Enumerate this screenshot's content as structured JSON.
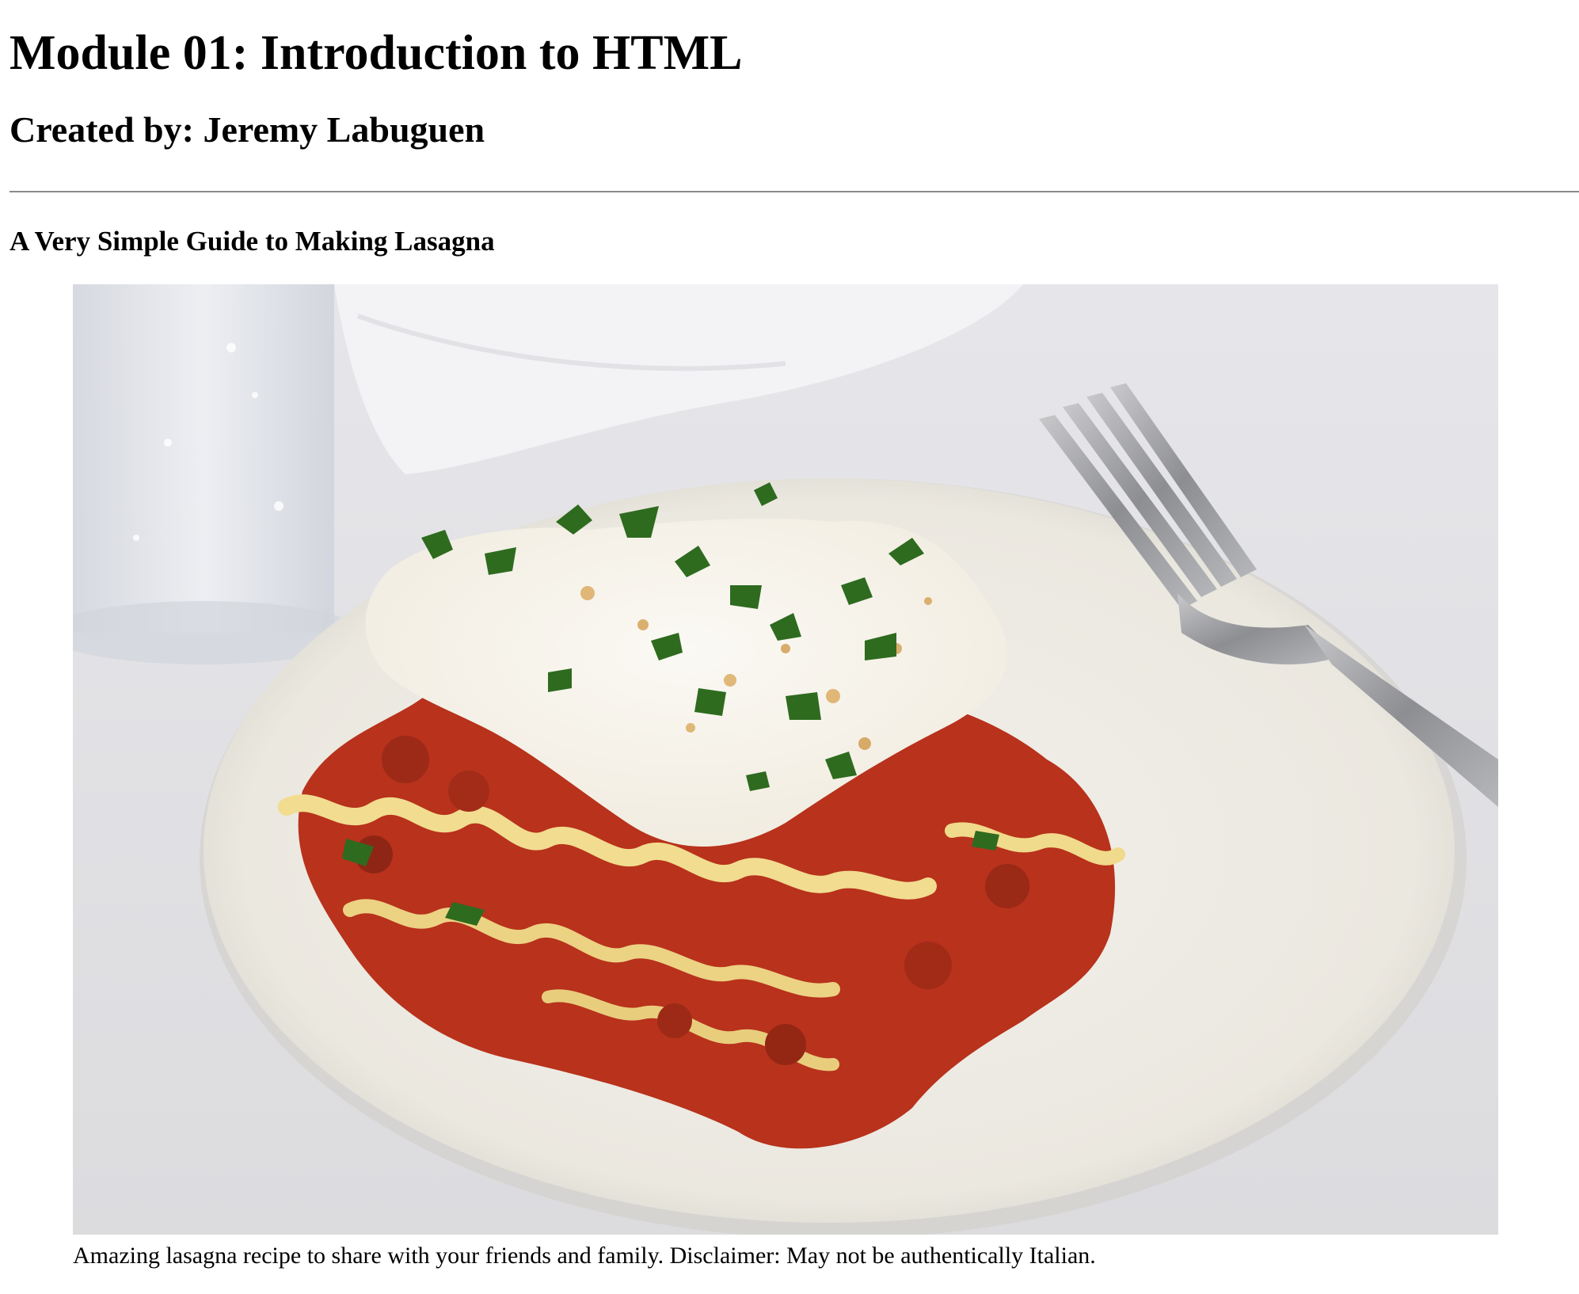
{
  "page": {
    "title": "Module 01: Introduction to HTML",
    "author_line": "Created by: Jeremy Labuguen",
    "section_heading": "A Very Simple Guide to Making Lasagna"
  },
  "figure": {
    "image_subject": "lasagna-photo",
    "caption": "Amazing lasagna recipe to share with your friends and family. Disclaimer: May not be authentically Italian."
  }
}
